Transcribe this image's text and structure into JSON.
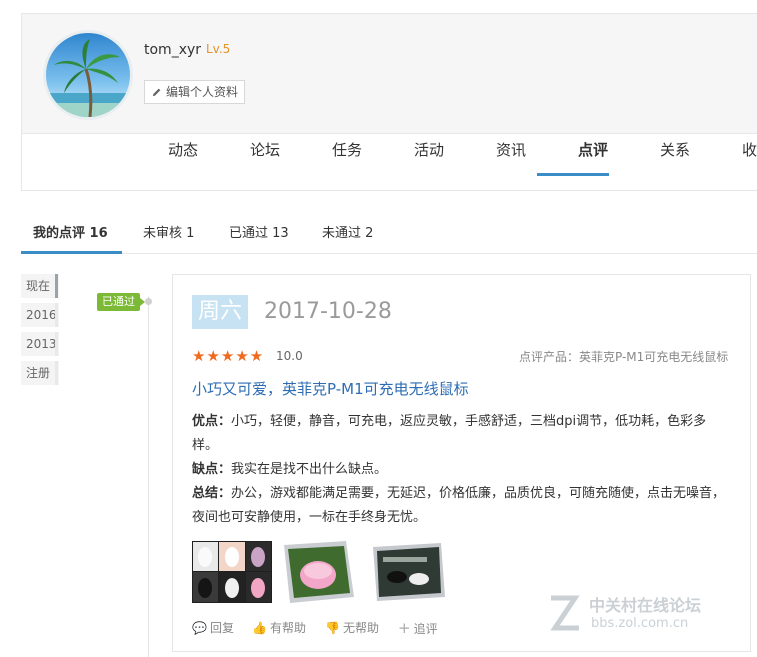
{
  "profile": {
    "username": "tom_xyr",
    "level": "Lv.5",
    "edit_label": "编辑个人资料"
  },
  "nav": {
    "items": [
      {
        "label": "动态"
      },
      {
        "label": "论坛"
      },
      {
        "label": "任务"
      },
      {
        "label": "活动"
      },
      {
        "label": "资讯"
      },
      {
        "label": "点评"
      },
      {
        "label": "关系"
      },
      {
        "label": "收"
      }
    ],
    "active": "点评"
  },
  "subtabs": [
    {
      "label": "我的点评 16"
    },
    {
      "label": "未审核 1"
    },
    {
      "label": "已通过 13"
    },
    {
      "label": "未通过 2"
    }
  ],
  "timeline": {
    "years": [
      {
        "label": "现在"
      },
      {
        "label": "2016"
      },
      {
        "label": "2013"
      },
      {
        "label": "注册"
      }
    ],
    "status_badge": "已通过"
  },
  "review": {
    "weekday": "周六",
    "date": "2017-10-28",
    "stars": "★★★★★",
    "score": "10.0",
    "product_ref": "点评产品：英菲克P-M1可充电无线鼠标",
    "title": "小巧又可爱，英菲克P-M1可充电无线鼠标",
    "pros_label": "优点：",
    "pros": "小巧，轻便，静音，可充电，返应灵敏，手感舒适，三档dpi调节，低功耗，色彩多样。",
    "cons_label": "缺点：",
    "cons": "我实在是找不出什么缺点。",
    "summary_label": "总结：",
    "summary": "办公，游戏都能满足需要，无延迟，价格低廉，品质优良，可随充随使，点击无噪音，夜间也可安静使用，一标在手终身无忧。",
    "actions": {
      "reply": "回复",
      "helpful": "有帮助",
      "unhelpful": "无帮助",
      "follow_up": "追评"
    }
  },
  "watermark": {
    "line1": "中关村在线论坛",
    "line2": "bbs.zol.com.cn"
  },
  "colors": {
    "accent": "#3b8dc8",
    "badge_green": "#7bb936",
    "star_orange": "#ef6a1f",
    "title_blue": "#2e6db4",
    "level_orange": "#e4932a"
  }
}
